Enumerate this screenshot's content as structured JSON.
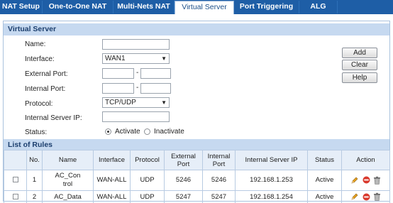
{
  "tabs": [
    {
      "label": "NAT Setup"
    },
    {
      "label": "One-to-One NAT"
    },
    {
      "label": "Multi-Nets NAT"
    },
    {
      "label": "Virtual Server"
    },
    {
      "label": "Port Triggering"
    },
    {
      "label": "ALG"
    }
  ],
  "active_tab": "Virtual Server",
  "form": {
    "title": "Virtual Server",
    "name_label": "Name:",
    "name_value": "",
    "interface_label": "Interface:",
    "interface_value": "WAN1",
    "external_port_label": "External Port:",
    "internal_port_label": "Internal Port:",
    "port_separator": "-",
    "protocol_label": "Protocol:",
    "protocol_value": "TCP/UDP",
    "server_ip_label": "Internal Server IP:",
    "server_ip_value": "",
    "status_label": "Status:",
    "status_options": [
      "Activate",
      "Inactivate"
    ],
    "status_selected": "Activate"
  },
  "buttons": {
    "add": "Add",
    "clear": "Clear",
    "help": "Help"
  },
  "rules": {
    "title": "List of Rules",
    "columns": [
      "No.",
      "Name",
      "Interface",
      "Protocol",
      "External Port",
      "Internal Port",
      "Internal Server IP",
      "Status",
      "Action"
    ],
    "rows": [
      {
        "no": "1",
        "name": "AC_Control",
        "interface": "WAN-ALL",
        "protocol": "UDP",
        "external_port": "5246",
        "internal_port": "5246",
        "server_ip": "192.168.1.253",
        "status": "Active"
      },
      {
        "no": "2",
        "name": "AC_Data",
        "interface": "WAN-ALL",
        "protocol": "UDP",
        "external_port": "5247",
        "internal_port": "5247",
        "server_ip": "192.168.1.254",
        "status": "Active"
      }
    ]
  },
  "icons": {
    "edit": "pencil-icon",
    "disable": "no-entry-icon",
    "delete": "trash-icon"
  },
  "colors": {
    "tab_bar": "#1e5ea6",
    "section_header": "#c6d9f0",
    "table_header": "#e6eef8"
  }
}
